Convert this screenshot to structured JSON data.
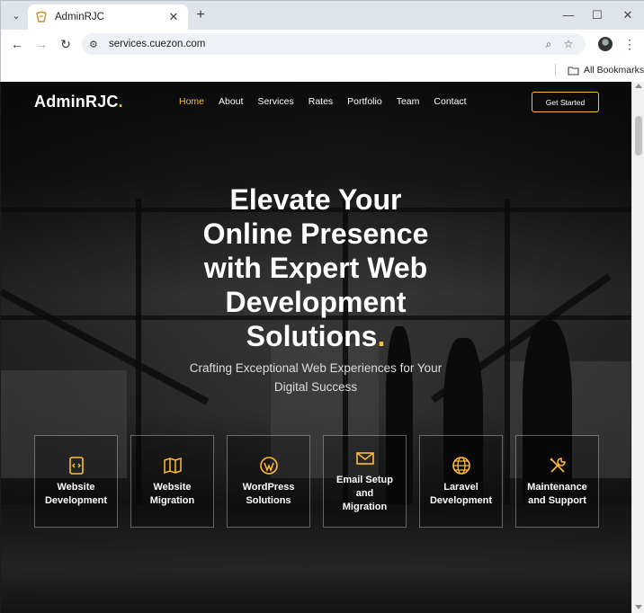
{
  "browser": {
    "tab_title": "AdminRJC",
    "url": "services.cuezon.com",
    "bookmarks_label": "All Bookmarks"
  },
  "site": {
    "logo": "AdminRJC",
    "logo_dot": ".",
    "nav": [
      {
        "label": "Home",
        "active": true
      },
      {
        "label": "About"
      },
      {
        "label": "Services"
      },
      {
        "label": "Rates"
      },
      {
        "label": "Portfolio"
      },
      {
        "label": "Team"
      },
      {
        "label": "Contact"
      }
    ],
    "cta_label": "Get Started",
    "hero": {
      "title_line1": "Elevate Your",
      "title_line2": "Online Presence",
      "title_line3": "with Expert Web",
      "title_line4": "Development",
      "title_line5": "Solutions",
      "title_dot": ".",
      "subtitle": "Crafting Exceptional Web Experiences for Your Digital Success"
    },
    "services": [
      {
        "label": "Website\nDevelopment",
        "icon": "code-file-icon"
      },
      {
        "label": "Website\nMigration",
        "icon": "map-icon"
      },
      {
        "label": "WordPress\nSolutions",
        "icon": "wordpress-icon"
      },
      {
        "label": "Email Setup\nand\nMigration",
        "icon": "envelope-icon"
      },
      {
        "label": "Laravel\nDevelopment",
        "icon": "globe-icon"
      },
      {
        "label": "Maintenance\nand Support",
        "icon": "tools-icon"
      }
    ]
  },
  "colors": {
    "accent": "#ffbc3b",
    "text": "#ffffff"
  }
}
